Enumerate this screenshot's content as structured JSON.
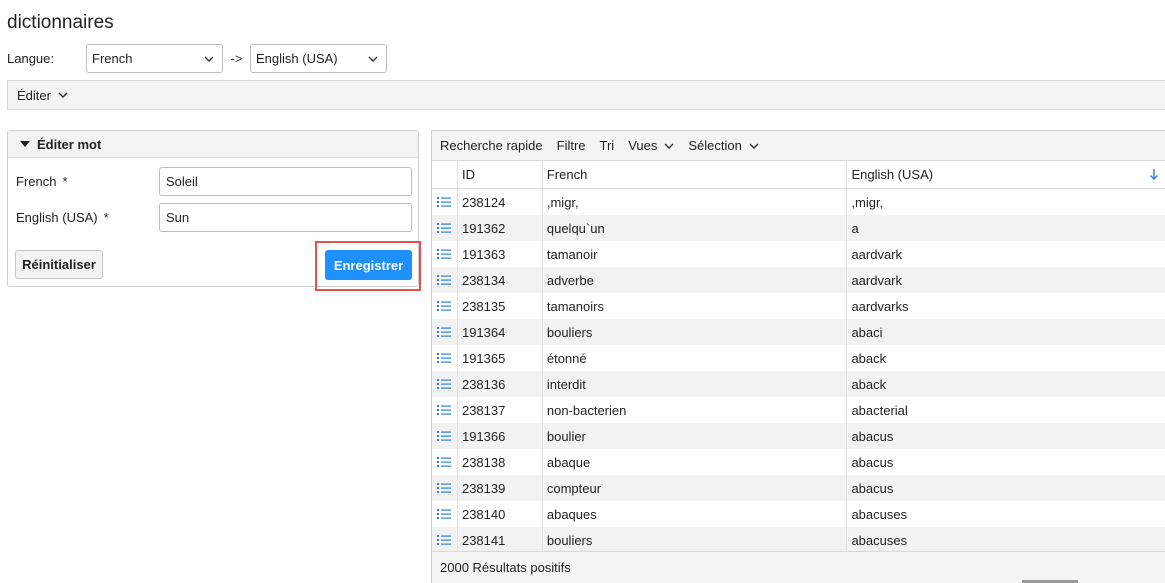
{
  "page": {
    "title": "dictionnaires"
  },
  "language": {
    "label": "Langue:",
    "source": "French",
    "separator": "->",
    "target": "English (USA)"
  },
  "edit_menu": {
    "label": "Éditer"
  },
  "edit_word": {
    "header": "Éditer mot",
    "fields": [
      {
        "label": "French",
        "required": "*",
        "value": "Soleil"
      },
      {
        "label": "English (USA)",
        "required": "*",
        "value": "Sun"
      }
    ],
    "reset_label": "Réinitialiser",
    "save_label": "Enregistrer"
  },
  "grid": {
    "toolbar": {
      "quick_search": "Recherche rapide",
      "filter": "Filtre",
      "sort": "Tri",
      "views": "Vues",
      "selection": "Sélection"
    },
    "columns": {
      "id": "ID",
      "french": "French",
      "english": "English (USA)"
    },
    "sort_icon": "arrow-down-icon",
    "row_icon": "list-icon",
    "rows": [
      {
        "id": "238124",
        "french": ",migr,",
        "english": ",migr,"
      },
      {
        "id": "191362",
        "french": "quelqu`un",
        "english": "a"
      },
      {
        "id": "191363",
        "french": "tamanoir",
        "english": "aardvark"
      },
      {
        "id": "238134",
        "french": "adverbe",
        "english": "aardvark"
      },
      {
        "id": "238135",
        "french": "tamanoirs",
        "english": "aardvarks"
      },
      {
        "id": "191364",
        "french": "bouliers",
        "english": "abaci"
      },
      {
        "id": "191365",
        "french": "étonné",
        "english": "aback"
      },
      {
        "id": "238136",
        "french": "interdit",
        "english": "aback"
      },
      {
        "id": "238137",
        "french": "non-bacterien",
        "english": "abacterial"
      },
      {
        "id": "191366",
        "french": "boulier",
        "english": "abacus"
      },
      {
        "id": "238138",
        "french": "abaque",
        "english": "abacus"
      },
      {
        "id": "238139",
        "french": "compteur",
        "english": "abacus"
      },
      {
        "id": "238140",
        "french": "abaques",
        "english": "abacuses"
      },
      {
        "id": "238141",
        "french": "bouliers",
        "english": "abacuses"
      }
    ],
    "footer": "2000 Résultats positifs"
  },
  "colors": {
    "accent": "#1e90ff",
    "highlight": "#e05252",
    "icon": "#2f7fd6"
  }
}
